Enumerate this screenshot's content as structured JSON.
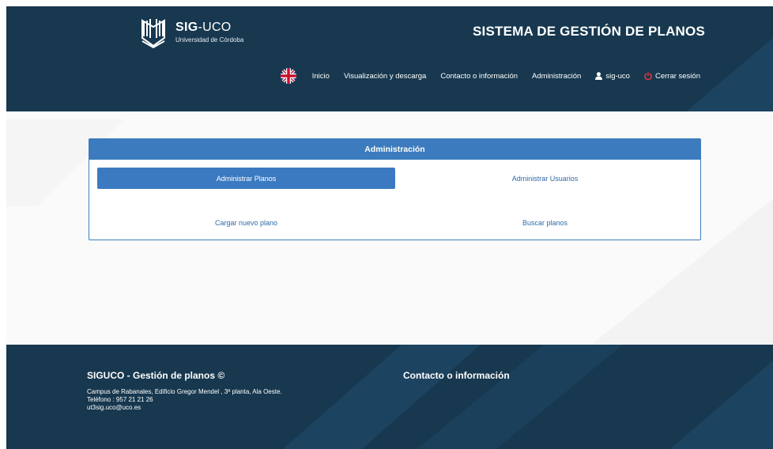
{
  "header": {
    "brand_bold": "SIG",
    "brand_rest": "-UCO",
    "brand_sub": "Universidad de Córdoba",
    "site_title": "SISTEMA DE GESTIÓN DE PLANOS",
    "nav": {
      "language_icon": "uk-flag-icon",
      "items": [
        {
          "label": "Inicio"
        },
        {
          "label": "Visualización y descarga"
        },
        {
          "label": "Contacto o información"
        },
        {
          "label": "Administración"
        },
        {
          "label": "sig-uco",
          "icon": "user-icon"
        },
        {
          "label": "Cerrar sesión",
          "icon": "power-icon"
        }
      ]
    }
  },
  "panel": {
    "title": "Administración",
    "buttons": [
      {
        "label": "Administrar Planos",
        "active": true
      },
      {
        "label": "Administrar Usuarios",
        "active": false
      },
      {
        "label": "Cargar nuevo plano",
        "active": false
      },
      {
        "label": "Buscar planos",
        "active": false
      }
    ]
  },
  "footer": {
    "title": "SIGUCO - Gestión de planos ©",
    "address": "Campus de Rabanales, Edificio Gregor Mendel , 3ª planta, Ala Oeste.",
    "phone": "Teléfono : 957 21 21 26",
    "email": "ut3sig.uco@uco.es",
    "contact_title": "Contacto o información"
  },
  "colors": {
    "header_bg": "#17384f",
    "accent": "#3c7bbd",
    "power": "#e0383e"
  }
}
